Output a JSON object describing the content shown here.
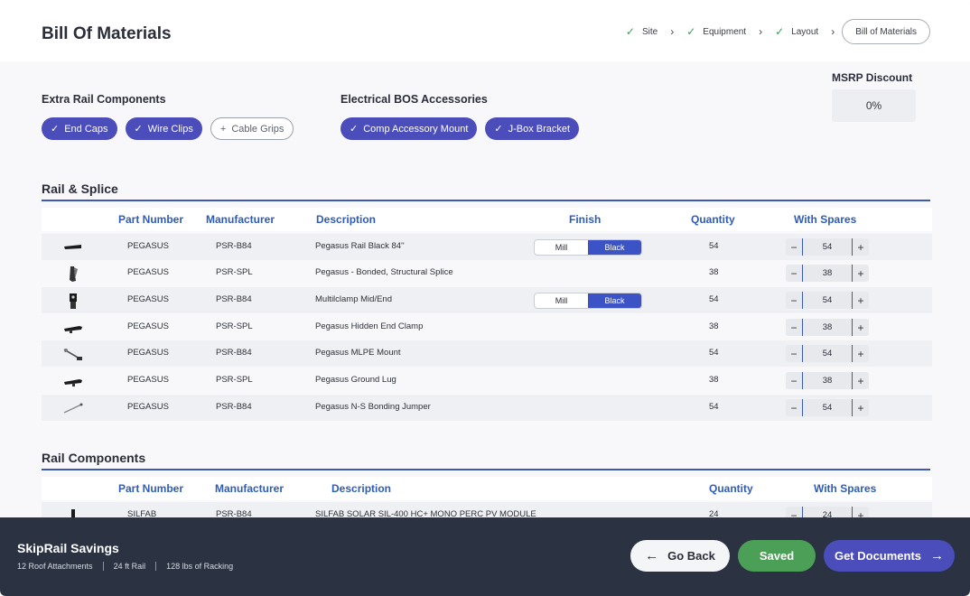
{
  "header": {
    "title": "Bill Of Materials",
    "steps": [
      {
        "label": "Site",
        "done": true
      },
      {
        "label": "Equipment",
        "done": true
      },
      {
        "label": "Layout",
        "done": true
      },
      {
        "label": "Bill of Materials",
        "done": false,
        "active": true
      }
    ]
  },
  "extra_rail": {
    "label": "Extra Rail Components",
    "chips": [
      {
        "label": "End Caps",
        "selected": true
      },
      {
        "label": "Wire Clips",
        "selected": true
      },
      {
        "label": "Cable Grips",
        "selected": false
      }
    ]
  },
  "electrical": {
    "label": "Electrical BOS Accessories",
    "chips": [
      {
        "label": "Comp Accessory Mount",
        "selected": true
      },
      {
        "label": "J-Box Bracket",
        "selected": true
      }
    ]
  },
  "msrp": {
    "label": "MSRP Discount",
    "value": "0%"
  },
  "rail_splice": {
    "title": "Rail & Splice",
    "headers": {
      "part_number": "Part Number",
      "manufacturer": "Manufacturer",
      "description": "Description",
      "finish": "Finish",
      "quantity": "Quantity",
      "with_spares": "With Spares"
    },
    "finish_options": {
      "mill": "Mill",
      "black": "Black"
    },
    "rows": [
      {
        "part": "PEGASUS",
        "mfr": "PSR-B84",
        "desc": "Pegasus Rail Black 84''",
        "finish": "Black",
        "qty": "54",
        "spares": "54"
      },
      {
        "part": "PEGASUS",
        "mfr": "PSR-SPL",
        "desc": "Pegasus - Bonded, Structural Splice",
        "finish": "",
        "qty": "38",
        "spares": "38"
      },
      {
        "part": "PEGASUS",
        "mfr": "PSR-B84",
        "desc": "Multilclamp Mid/End",
        "finish": "Black",
        "qty": "54",
        "spares": "54"
      },
      {
        "part": "PEGASUS",
        "mfr": "PSR-SPL",
        "desc": "Pegasus Hidden End Clamp",
        "finish": "",
        "qty": "38",
        "spares": "38"
      },
      {
        "part": "PEGASUS",
        "mfr": "PSR-B84",
        "desc": "Pegasus MLPE Mount",
        "finish": "",
        "qty": "54",
        "spares": "54"
      },
      {
        "part": "PEGASUS",
        "mfr": "PSR-SPL",
        "desc": "Pegasus Ground Lug",
        "finish": "",
        "qty": "38",
        "spares": "38"
      },
      {
        "part": "PEGASUS",
        "mfr": "PSR-B84",
        "desc": "Pegasus N-S Bonding Jumper",
        "finish": "",
        "qty": "54",
        "spares": "54"
      }
    ]
  },
  "rail_components": {
    "title": "Rail Components",
    "headers": {
      "part_number": "Part Number",
      "manufacturer": "Manufacturer",
      "description": "Description",
      "quantity": "Quantity",
      "with_spares": "With Spares"
    },
    "rows": [
      {
        "part": "SILFAB",
        "mfr": "PSR-B84",
        "desc": "SILFAB SOLAR SIL-400 HC+ MONO PERC PV MODULE",
        "qty": "24",
        "spares": "24"
      }
    ]
  },
  "footer": {
    "title": "SkipRail Savings",
    "stats": [
      "12 Roof Attachments",
      "24 ft Rail",
      "128 lbs of Racking"
    ],
    "go_back": "Go Back",
    "saved": "Saved",
    "get_documents": "Get Documents"
  },
  "icons": {
    "check": "check-icon",
    "chevron": "chevron-right-icon",
    "plus": "plus-icon",
    "minus": "minus-icon",
    "arrow_left": "arrow-left-icon",
    "arrow_right": "arrow-right-icon"
  },
  "colors": {
    "accent": "#4b4dbb",
    "table_header": "#2f5cb8",
    "success": "#4c9f57",
    "footer_bg": "#2b3242",
    "check": "#3a9b5a"
  }
}
